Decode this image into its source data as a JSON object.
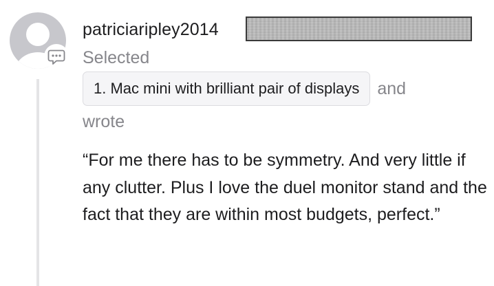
{
  "comment": {
    "username": "patriciaripley2014",
    "selected_label": "Selected",
    "choice_label": "1. Mac mini with brilliant pair of displays",
    "and_label": "and",
    "wrote_label": "wrote",
    "quote": "“For me there has to be symmetry. And very little if any clutter. Plus I love the duel monitor stand and the fact that they are within most budgets, perfect.”"
  },
  "icons": {
    "avatar": "default-user-avatar",
    "badge": "comment-bubble-icon"
  },
  "colors": {
    "text_primary": "#1d1d1f",
    "text_secondary": "#86868b",
    "avatar_gray": "#c7c7cc",
    "chip_background": "#f5f5f7",
    "thread_line": "#e4e4e6",
    "redaction": "#b6b6b6"
  }
}
